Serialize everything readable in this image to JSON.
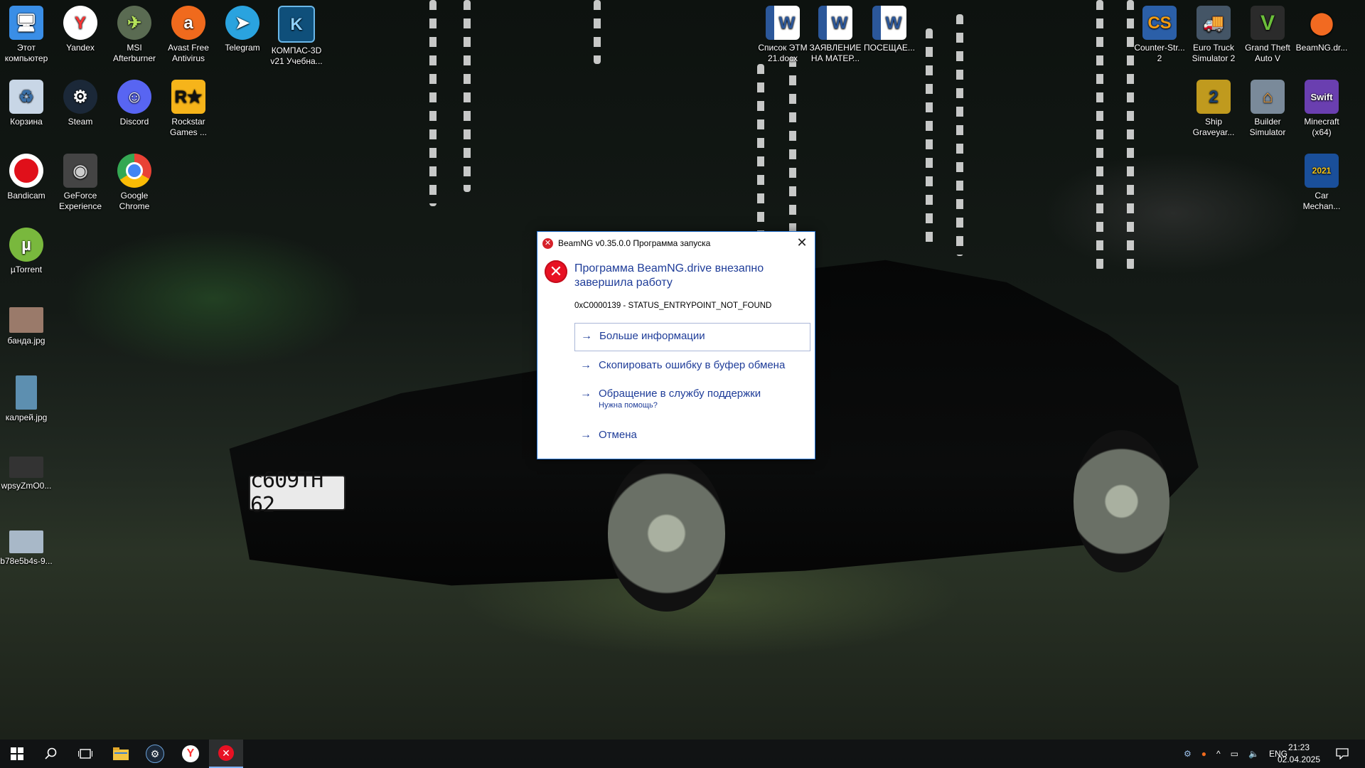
{
  "desktop": {
    "icons_left": [
      {
        "label": "Этот компьютер",
        "icon": "this-pc-icon",
        "color": "#3a8ee6"
      },
      {
        "label": "Yandex",
        "icon": "yandex-icon",
        "color": "#ffffff"
      },
      {
        "label": "MSI Afterburner",
        "icon": "msi-afterburner-icon",
        "color": "#5a6b52"
      },
      {
        "label": "Avast Free Antivirus",
        "icon": "avast-icon",
        "color": "#f06a1d"
      },
      {
        "label": "Telegram",
        "icon": "telegram-icon",
        "color": "#2aa3df"
      },
      {
        "label": "КОМПАС-3D v21 Учебна...",
        "icon": "kompas-icon",
        "color": "#1b6ea8"
      },
      {
        "label": "Корзина",
        "icon": "recycle-bin-icon",
        "color": "#c8d6e6"
      },
      {
        "label": "Steam",
        "icon": "steam-icon",
        "color": "#1b2838"
      },
      {
        "label": "Discord",
        "icon": "discord-icon",
        "color": "#5865f2"
      },
      {
        "label": "Rockstar Games ...",
        "icon": "rockstar-icon",
        "color": "#f6b41a"
      },
      {
        "label": "Bandicam",
        "icon": "bandicam-icon",
        "color": "#e0101a"
      },
      {
        "label": "GeForce Experience",
        "icon": "geforce-icon",
        "color": "#444"
      },
      {
        "label": "Google Chrome",
        "icon": "chrome-icon",
        "color": "#e94235"
      },
      {
        "label": "µTorrent",
        "icon": "utorrent-icon",
        "color": "#79b83d"
      },
      {
        "label": "банда.jpg",
        "icon": "image-file-icon",
        "color": "#9a7a6a"
      },
      {
        "label": "калрей.jpg",
        "icon": "image-file-icon",
        "color": "#5d8fb0"
      },
      {
        "label": "wpsyZmO0...",
        "icon": "image-file-icon",
        "color": "#333"
      },
      {
        "label": "b78e5b4s-9...",
        "icon": "image-file-icon",
        "color": "#a8b8c8"
      }
    ],
    "icons_docs": [
      {
        "label": "Список ЭТМ 21.docx",
        "icon": "word-doc-icon"
      },
      {
        "label": "ЗАЯВЛЕНИЕ НА МАТЕР...",
        "icon": "word-doc-icon"
      },
      {
        "label": "ПОСЕЩАЕ...",
        "icon": "word-doc-icon"
      }
    ],
    "icons_right": [
      {
        "label": "Counter-Str... 2",
        "icon": "counter-strike-icon",
        "color": "#2b5fa8"
      },
      {
        "label": "Euro Truck Simulator 2",
        "icon": "euro-truck-icon",
        "color": "#445566"
      },
      {
        "label": "Grand Theft Auto V",
        "icon": "gta-v-icon",
        "color": "#2b2b2b"
      },
      {
        "label": "BeamNG.dr...",
        "icon": "beamng-icon",
        "color": "#f26a21"
      },
      {
        "label": "Ship Graveyar...",
        "icon": "ship-graveyard-icon",
        "color": "#c09a1e"
      },
      {
        "label": "Builder Simulator",
        "icon": "builder-simulator-icon",
        "color": "#7a8a9a"
      },
      {
        "label": "Minecraft (x64)",
        "icon": "minecraft-icon",
        "color": "#6a3fb0"
      },
      {
        "label": "Car Mechan...",
        "icon": "car-mechanic-icon",
        "color": "#1a4f9a"
      }
    ],
    "plate": "с609ТН 62"
  },
  "dialog": {
    "title": "BeamNG v0.35.0.0 Программа запуска",
    "close": "✕",
    "main_instruction": "Программа BeamNG.drive внезапно завершила работу",
    "error_code": "0xC0000139 - STATUS_ENTRYPOINT_NOT_FOUND",
    "commands": [
      {
        "label": "Больше информации",
        "sub": ""
      },
      {
        "label": "Скопировать ошибку в буфер обмена",
        "sub": ""
      },
      {
        "label": "Обращение в службу поддержки",
        "sub": "Нужна помощь?"
      },
      {
        "label": "Отмена",
        "sub": ""
      }
    ]
  },
  "taskbar": {
    "buttons": [
      "start-icon",
      "search-icon",
      "task-view-icon",
      "file-explorer-icon",
      "steam-icon",
      "yandex-icon",
      "beamng-error-icon"
    ],
    "language": "ENG",
    "time": "21:23",
    "date": "02.04.2025"
  }
}
